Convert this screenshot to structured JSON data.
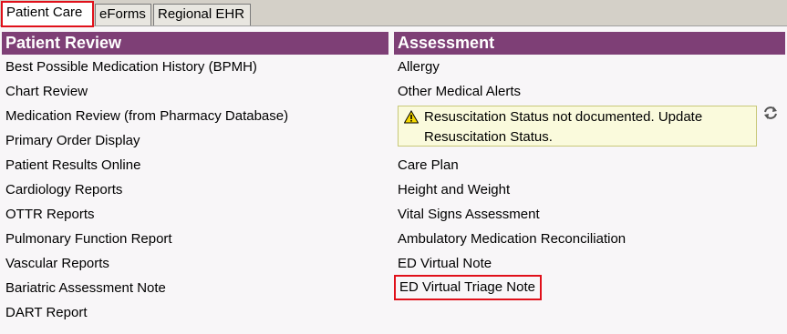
{
  "tabs": [
    {
      "label": "Patient Care",
      "active": true
    },
    {
      "label": "eForms",
      "active": false
    },
    {
      "label": "Regional EHR",
      "active": false
    }
  ],
  "patient_review": {
    "header": "Patient Review",
    "items": [
      "Best Possible Medication History (BPMH)",
      "Chart Review",
      "Medication Review (from Pharmacy Database)",
      "Primary Order Display",
      "Patient Results Online",
      "Cardiology Reports",
      "OTTR Reports",
      "Pulmonary Function Report",
      "Vascular Reports",
      "Bariatric Assessment Note",
      "DART Report"
    ]
  },
  "assessment": {
    "header": "Assessment",
    "items_before_alert": [
      "Allergy",
      "Other Medical Alerts"
    ],
    "alert": {
      "line1": "Resuscitation Status not documented. Update",
      "line2": "Resuscitation Status.",
      "icon": "warning-icon"
    },
    "items_after_alert": [
      "Care Plan",
      "Height and Weight",
      "Vital Signs Assessment",
      "Ambulatory Medication Reconciliation",
      "ED Virtual Note",
      "ED Virtual Triage Note"
    ],
    "highlighted_item": "ED Virtual Triage Note"
  },
  "colors": {
    "header_bg": "#7e3f76",
    "highlight_border": "#e0101a",
    "alert_bg": "#fafadc"
  }
}
